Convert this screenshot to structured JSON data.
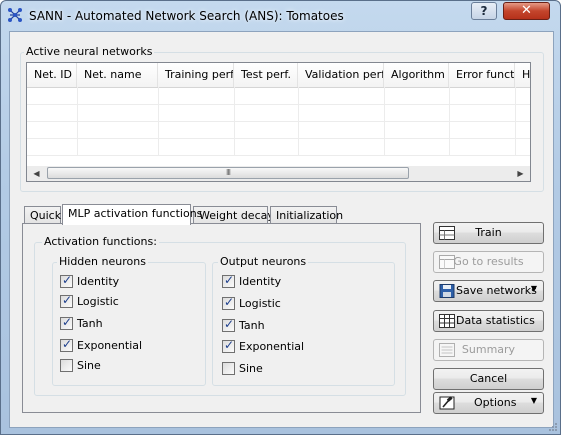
{
  "window": {
    "title": "SANN - Automated Network Search (ANS): Tomatoes",
    "help_label": "?",
    "close_label": "✕"
  },
  "networks_group": {
    "legend": "Active neural networks",
    "columns": [
      "Net. ID",
      "Net. name",
      "Training perf.",
      "Test perf.",
      "Validation perf.",
      "Algorithm",
      "Error funct.",
      "H"
    ],
    "rows": [],
    "scroll_left": "◀",
    "scroll_right": "▶",
    "thumb_grip": "III"
  },
  "tabs": [
    {
      "label": "Quick",
      "active": false
    },
    {
      "label": "MLP activation functions",
      "active": true
    },
    {
      "label": "Weight decay",
      "active": false
    },
    {
      "label": "Initialization",
      "active": false
    }
  ],
  "activation": {
    "legend": "Activation functions:",
    "hidden": {
      "legend": "Hidden neurons",
      "items": [
        {
          "label": "Identity",
          "checked": true
        },
        {
          "label": "Logistic",
          "checked": true
        },
        {
          "label": "Tanh",
          "checked": true
        },
        {
          "label": "Exponential",
          "checked": true
        },
        {
          "label": "Sine",
          "checked": false
        }
      ]
    },
    "output": {
      "legend": "Output neurons",
      "items": [
        {
          "label": "Identity",
          "checked": true
        },
        {
          "label": "Logistic",
          "checked": true
        },
        {
          "label": "Tanh",
          "checked": true
        },
        {
          "label": "Exponential",
          "checked": true
        },
        {
          "label": "Sine",
          "checked": false
        }
      ]
    }
  },
  "buttons": {
    "train": "Train",
    "go_to_results": "Go to results",
    "save_networks": "Save networks",
    "data_statistics": "Data statistics",
    "summary": "Summary",
    "cancel": "Cancel",
    "options": "Options"
  },
  "colors": {
    "title_gradient_top": "#c4d9ee",
    "close_button": "#c4452c",
    "check_mark": "#1e3f8c",
    "disabled_text": "#9c9c9c"
  }
}
